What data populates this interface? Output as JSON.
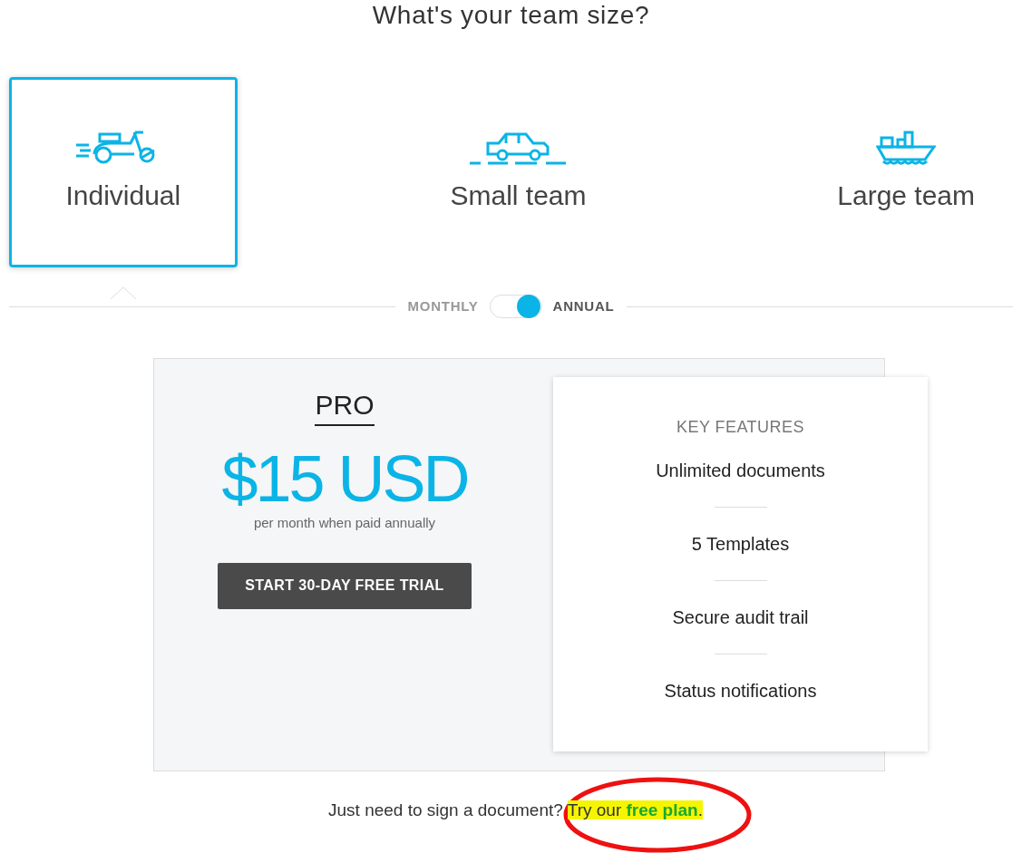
{
  "heading": "What's your team size?",
  "team_options": [
    {
      "label": "Individual",
      "kind": "scooter",
      "selected": true
    },
    {
      "label": "Small team",
      "kind": "car",
      "selected": false
    },
    {
      "label": "Large team",
      "kind": "ship",
      "selected": false
    }
  ],
  "billing": {
    "left": "MONTHLY",
    "right": "ANNUAL",
    "annual": true
  },
  "plan": {
    "name": "PRO",
    "price": "$15 USD",
    "price_note": "per month when paid annually",
    "cta": "START 30-DAY FREE TRIAL"
  },
  "features": {
    "title": "KEY FEATURES",
    "items": [
      "Unlimited documents",
      "5 Templates",
      "Secure audit trail",
      "Status notifications"
    ]
  },
  "footer": {
    "text": "Just need to sign a document? ",
    "highlight_text": "Try our ",
    "link": "free plan",
    "end": ".",
    "highlighted": true,
    "circled": true
  }
}
